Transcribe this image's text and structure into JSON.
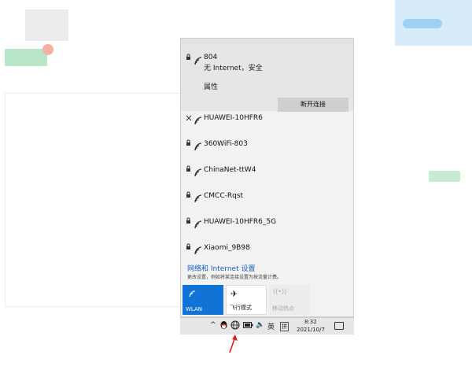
{
  "connected": {
    "name": "804",
    "status": "无 Internet，安全",
    "properties_label": "属性",
    "disconnect_label": "断开连接"
  },
  "networks": [
    {
      "name": "HUAWEI-10HFR6",
      "secured": false
    },
    {
      "name": "360WiFi-803",
      "secured": true
    },
    {
      "name": "ChinaNet-ttW4",
      "secured": true
    },
    {
      "name": "CMCC-Rqst",
      "secured": true
    },
    {
      "name": "HUAWEI-10HFR6_5G",
      "secured": true
    },
    {
      "name": "Xiaomi_9B98",
      "secured": true
    }
  ],
  "settings": {
    "link": "网络和 Internet 设置",
    "description": "更改设置，例如将某连接设置为按流量计费。"
  },
  "quick_actions": {
    "wlan": "WLAN",
    "airplane": "飞行模式",
    "hotspot": "移动热点"
  },
  "taskbar": {
    "time": "8:32",
    "date": "2021/10/7",
    "ime": "英",
    "ime_mode": "拼",
    "chevron": "^"
  },
  "colors": {
    "accent": "#1273d6",
    "arrow": "#e02020"
  }
}
